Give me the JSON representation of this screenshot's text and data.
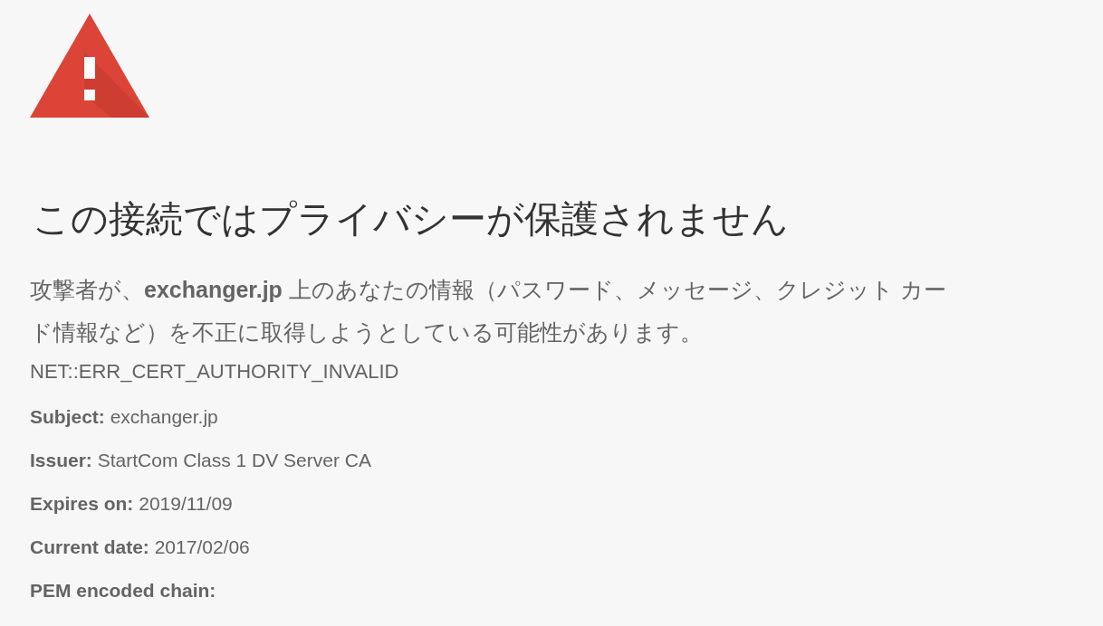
{
  "heading": "この接続ではプライバシーが保護されません",
  "description_lines": [
    "攻撃者が、**exchanger.jp** 上のあなたの情報（パスワード、メッセージ、クレジット カー",
    "ド情報など）を不正に取得しようとしている可能性があります。"
  ],
  "error_code": "NET::ERR_CERT_AUTHORITY_INVALID",
  "details": [
    {
      "label": "Subject:",
      "value": "exchanger.jp"
    },
    {
      "label": "Issuer:",
      "value": "StartCom Class 1 DV Server CA"
    },
    {
      "label": "Expires on:",
      "value": "2019/11/09"
    },
    {
      "label": "Current date:",
      "value": "2017/02/06"
    },
    {
      "label": "PEM encoded chain:"
    }
  ]
}
